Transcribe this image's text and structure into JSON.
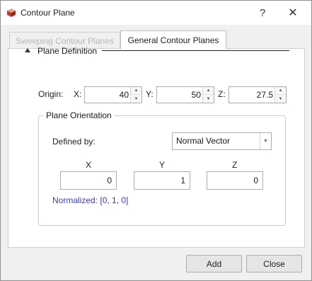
{
  "window": {
    "title": "Contour Plane",
    "help_glyph": "?",
    "close_glyph": "✕"
  },
  "tabs": [
    {
      "label": "Sweeping Contour Planes",
      "active": false
    },
    {
      "label": "General Contour Planes",
      "active": true
    }
  ],
  "plane_definition": {
    "header": "Plane Definition",
    "origin_label": "Origin:",
    "x_label": "X:",
    "x_value": "40",
    "y_label": "Y:",
    "y_value": "50",
    "z_label": "Z:",
    "z_value": "27.5"
  },
  "plane_orientation": {
    "title": "Plane Orientation",
    "defined_by_label": "Defined by:",
    "defined_by_value": "Normal Vector",
    "col_x": "X",
    "col_y": "Y",
    "col_z": "Z",
    "x_value": "0",
    "y_value": "1",
    "z_value": "0",
    "normalized_text": "Normalized: [0, 1, 0]"
  },
  "buttons": {
    "add": "Add",
    "close": "Close"
  },
  "colors": {
    "accent_text": "#3a3ac0",
    "disabled_text": "#b8b8b8"
  }
}
